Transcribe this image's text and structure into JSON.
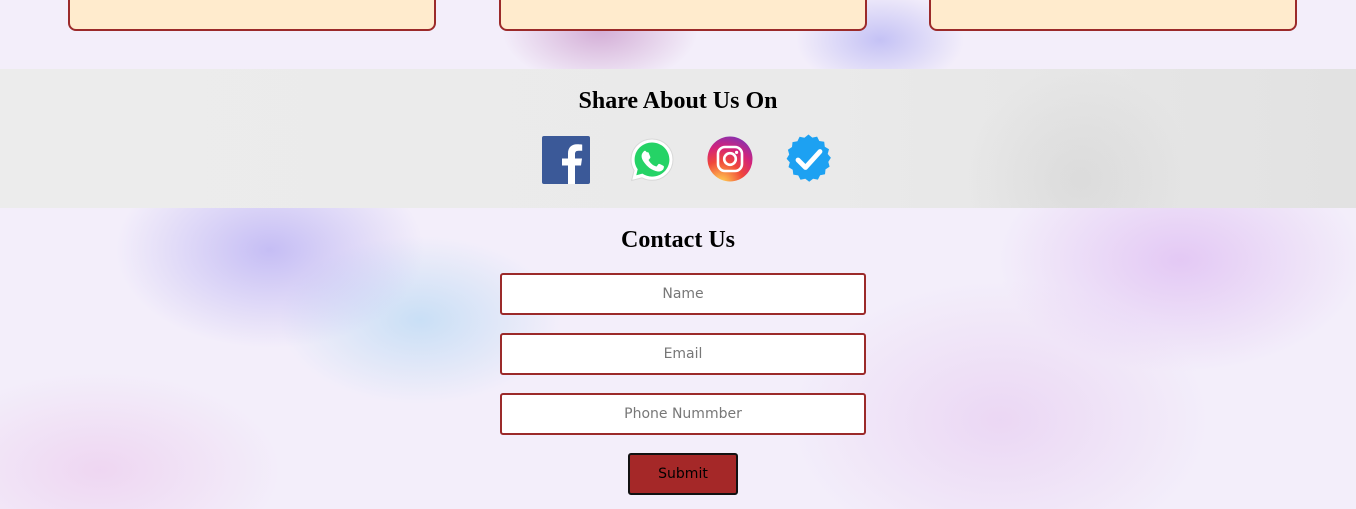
{
  "share": {
    "title": "Share About Us On",
    "icons": [
      "facebook-icon",
      "whatsapp-icon",
      "instagram-icon",
      "verified-badge-icon"
    ]
  },
  "contact": {
    "title": "Contact Us",
    "name_placeholder": "Name",
    "email_placeholder": "Email",
    "phone_placeholder": "Phone Nummber",
    "submit_label": "Submit"
  },
  "colors": {
    "card_bg": "#ffebcd",
    "accent": "#9b2a2a",
    "submit_bg": "#a52828",
    "facebook": "#3b5998",
    "whatsapp": "#25d366",
    "verified": "#1da1f2"
  }
}
